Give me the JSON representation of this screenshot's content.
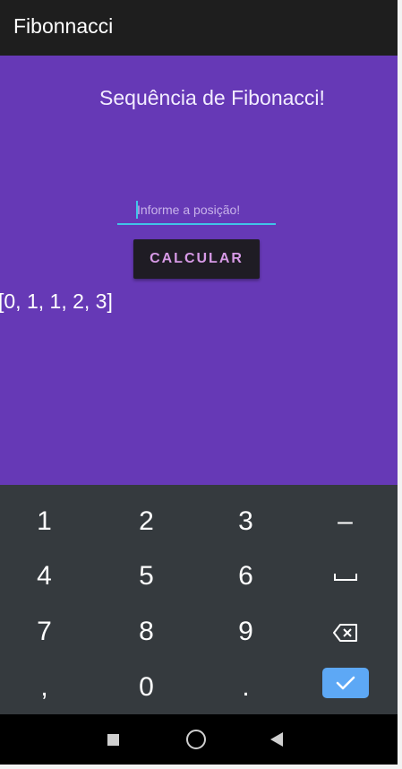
{
  "app_bar": {
    "title": "Fibonnacci"
  },
  "main": {
    "heading": "Sequência de Fibonacci!",
    "position_input": {
      "value": "",
      "placeholder": "Informe a posição!"
    },
    "calculate_button": {
      "label": "CALCULAR"
    },
    "result": "[0, 1, 1, 2, 3]"
  },
  "keyboard": {
    "keys": [
      "1",
      "2",
      "3",
      "–",
      "4",
      "5",
      "6",
      "␣",
      "7",
      "8",
      "9",
      "⌫",
      ",",
      "0",
      "."
    ],
    "done_icon": "check-icon",
    "space_icon": "space-icon",
    "backspace_icon": "backspace-icon"
  },
  "navigation_bar": {
    "icons": [
      "recents-square-icon",
      "home-circle-icon",
      "back-triangle-icon"
    ]
  },
  "colors": {
    "app_background": "#6639b6",
    "app_bar": "#1e1e1e",
    "input_accent": "#41c4e8",
    "button_background": "#1f1c24",
    "button_text": "#d79ae6",
    "keyboard_background": "#353a3e",
    "done_key": "#5da8f5"
  }
}
